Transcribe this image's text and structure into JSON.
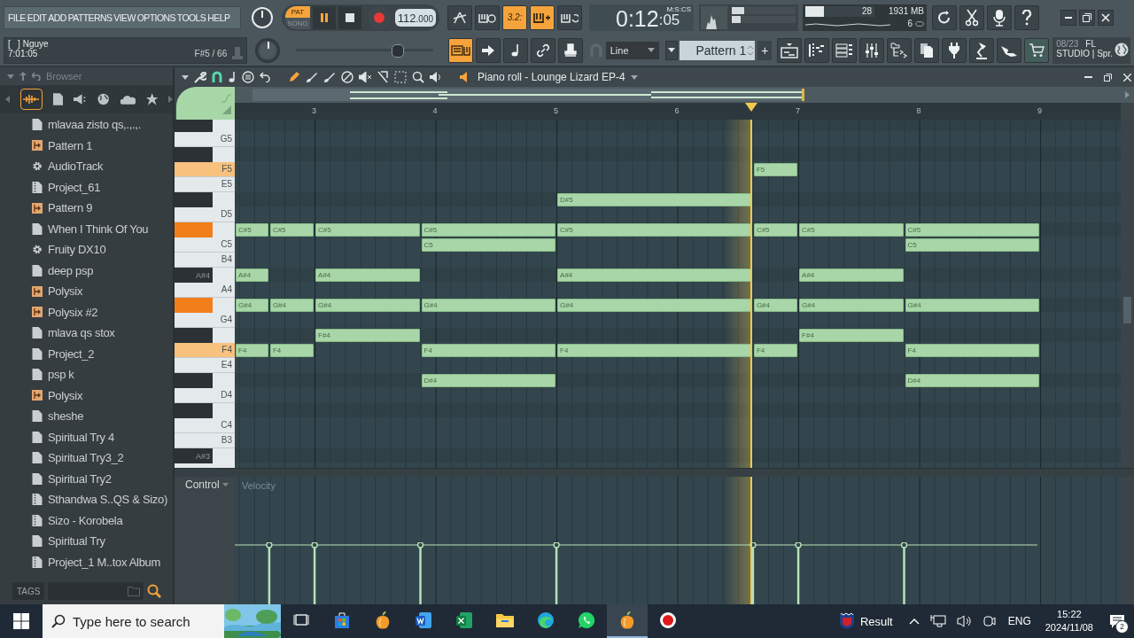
{
  "menu": [
    "FILE",
    "EDIT",
    "ADD",
    "PATTERNS",
    "VIEW",
    "OPTIONS",
    "TOOLS",
    "HELP"
  ],
  "transport": {
    "modes": [
      {
        "label": "PAT",
        "selected": true
      },
      {
        "label": "SONG",
        "selected": false
      }
    ],
    "playing": true,
    "tempo": "112",
    "tempo_decimals": ".000"
  },
  "toggles_top": [
    {
      "on": false
    },
    {
      "on": false
    },
    {
      "label": "3.2:",
      "on": true
    },
    {
      "on": true
    },
    {
      "on": false
    }
  ],
  "time": {
    "main": "0:12",
    "small": ":05",
    "format": "M:S:CS"
  },
  "cpu": {
    "level": 0.27,
    "reading": "28",
    "memory": "1931 MB",
    "polyphony": "6"
  },
  "hint": {
    "title": "[   ] Nguye",
    "time": "7:01:05",
    "note": "F#5 / 66"
  },
  "pitch_slider": {
    "level": 0.74
  },
  "toggles_bottom": [
    {
      "on": true
    },
    {
      "on": false
    },
    {
      "on": false
    },
    {
      "on": false
    },
    {
      "on": false
    }
  ],
  "snap": "Line",
  "pattern": "Pattern 1",
  "add": "+",
  "news": {
    "date": "08/23",
    "brand": "FL",
    "line2": "STUDIO | Spr."
  },
  "browser": {
    "title": "Browser",
    "items": [
      {
        "kind": "file",
        "label": "mlavaa zisto qs,.,.,."
      },
      {
        "kind": "pattern",
        "label": "Pattern 1"
      },
      {
        "kind": "plugin",
        "label": "AudioTrack"
      },
      {
        "kind": "project",
        "label": "Project_61"
      },
      {
        "kind": "pattern",
        "label": "Pattern 9"
      },
      {
        "kind": "file",
        "label": "When I Think Of You"
      },
      {
        "kind": "plugin",
        "label": "Fruity DX10"
      },
      {
        "kind": "file",
        "label": "deep psp"
      },
      {
        "kind": "pattern",
        "label": "Polysix"
      },
      {
        "kind": "pattern",
        "label": "Polysix #2"
      },
      {
        "kind": "file",
        "label": "mlava qs stox"
      },
      {
        "kind": "file",
        "label": "Project_2"
      },
      {
        "kind": "file",
        "label": "psp k"
      },
      {
        "kind": "pattern",
        "label": "Polysix"
      },
      {
        "kind": "file",
        "label": "sheshe"
      },
      {
        "kind": "file",
        "label": "Spiritual Try 4"
      },
      {
        "kind": "file",
        "label": "Spiritual Try3_2"
      },
      {
        "kind": "file",
        "label": "Spiritual Try2"
      },
      {
        "kind": "project",
        "label": "Sthandwa S..QS & Sizo)"
      },
      {
        "kind": "project",
        "label": "Sizo - Korobela"
      },
      {
        "kind": "file",
        "label": "Spiritual Try"
      },
      {
        "kind": "project",
        "label": "Project_1 M..tox Album"
      }
    ],
    "tags": "TAGS"
  },
  "piano_roll": {
    "title": "Piano roll - Lounge Lizard EP-4",
    "ruler": [
      "3",
      "4",
      "5",
      "6",
      "7",
      "8",
      "9"
    ],
    "playhead": {
      "level": 0.583
    },
    "keys": [
      {
        "kind": "black",
        "pressed": false
      },
      {
        "kind": "white",
        "label": "G5",
        "pressed": false
      },
      {
        "kind": "black",
        "pressed": false
      },
      {
        "kind": "white",
        "label": "F5",
        "pressed": true,
        "cells": [
          {
            "kind": "rest"
          },
          {
            "kind": "rest"
          },
          {
            "kind": "rest"
          },
          {
            "kind": "rest"
          },
          {
            "kind": "rest"
          },
          {
            "kind": "note",
            "label": "F5"
          },
          {
            "kind": "rest"
          },
          {
            "kind": "rest"
          }
        ]
      },
      {
        "kind": "white",
        "label": "E5",
        "pressed": false
      },
      {
        "kind": "black",
        "pressed": false,
        "cells": [
          {
            "kind": "rest"
          },
          {
            "kind": "rest"
          },
          {
            "kind": "rest"
          },
          {
            "kind": "rest"
          },
          {
            "kind": "note",
            "label": "D#5"
          },
          {
            "kind": "rest"
          },
          {
            "kind": "rest"
          },
          {
            "kind": "rest"
          }
        ]
      },
      {
        "kind": "white",
        "label": "D5",
        "pressed": false
      },
      {
        "kind": "black",
        "pressed": true,
        "cells": [
          {
            "kind": "note",
            "label": "C#5"
          },
          {
            "kind": "note",
            "label": "C#5"
          },
          {
            "kind": "note",
            "label": "C#5"
          },
          {
            "kind": "note",
            "label": "C#5"
          },
          {
            "kind": "note",
            "label": "C#5"
          },
          {
            "kind": "note",
            "label": "C#5"
          },
          {
            "kind": "note",
            "label": "C#5"
          },
          {
            "kind": "note",
            "label": "C#5"
          }
        ]
      },
      {
        "kind": "white",
        "label": "C5",
        "pressed": false,
        "cells": [
          {
            "kind": "rest"
          },
          {
            "kind": "rest"
          },
          {
            "kind": "rest"
          },
          {
            "kind": "note",
            "label": "C5"
          },
          {
            "kind": "rest"
          },
          {
            "kind": "rest"
          },
          {
            "kind": "rest"
          },
          {
            "kind": "note",
            "label": "C5"
          }
        ]
      },
      {
        "kind": "white",
        "label": "B4",
        "pressed": false
      },
      {
        "kind": "black",
        "label": "A#4",
        "pressed": false,
        "cells": [
          {
            "kind": "note",
            "label": "A#4"
          },
          {
            "kind": "rest"
          },
          {
            "kind": "note",
            "label": "A#4"
          },
          {
            "kind": "rest"
          },
          {
            "kind": "note",
            "label": "A#4"
          },
          {
            "kind": "rest"
          },
          {
            "kind": "note",
            "label": "A#4"
          },
          {
            "kind": "rest"
          }
        ]
      },
      {
        "kind": "white",
        "label": "A4",
        "pressed": false
      },
      {
        "kind": "black",
        "pressed": true,
        "cells": [
          {
            "kind": "note",
            "label": "G#4"
          },
          {
            "kind": "note",
            "label": "G#4"
          },
          {
            "kind": "note",
            "label": "G#4"
          },
          {
            "kind": "note",
            "label": "G#4"
          },
          {
            "kind": "note",
            "label": "G#4"
          },
          {
            "kind": "note",
            "label": "G#4"
          },
          {
            "kind": "note",
            "label": "G#4"
          },
          {
            "kind": "note",
            "label": "G#4"
          }
        ]
      },
      {
        "kind": "white",
        "label": "G4",
        "pressed": false
      },
      {
        "kind": "black",
        "pressed": false,
        "cells": [
          {
            "kind": "rest"
          },
          {
            "kind": "rest"
          },
          {
            "kind": "note",
            "label": "F#4"
          },
          {
            "kind": "rest"
          },
          {
            "kind": "rest"
          },
          {
            "kind": "rest"
          },
          {
            "kind": "note",
            "label": "F#4"
          },
          {
            "kind": "rest"
          }
        ]
      },
      {
        "kind": "white",
        "label": "F4",
        "pressed": true,
        "cells": [
          {
            "kind": "note",
            "label": "F4"
          },
          {
            "kind": "note",
            "label": "F4"
          },
          {
            "kind": "rest"
          },
          {
            "kind": "note",
            "label": "F4"
          },
          {
            "kind": "note",
            "label": "F4"
          },
          {
            "kind": "note",
            "label": "F4"
          },
          {
            "kind": "rest"
          },
          {
            "kind": "note",
            "label": "F4"
          }
        ]
      },
      {
        "kind": "white",
        "label": "E4",
        "pressed": false
      },
      {
        "kind": "black",
        "pressed": false,
        "cells": [
          {
            "kind": "rest"
          },
          {
            "kind": "rest"
          },
          {
            "kind": "rest"
          },
          {
            "kind": "note",
            "label": "D#4"
          },
          {
            "kind": "rest"
          },
          {
            "kind": "rest"
          },
          {
            "kind": "rest"
          },
          {
            "kind": "note",
            "label": "D#4"
          }
        ]
      },
      {
        "kind": "white",
        "label": "D4",
        "pressed": false
      },
      {
        "kind": "black",
        "pressed": false
      },
      {
        "kind": "white",
        "label": "C4",
        "pressed": false
      },
      {
        "kind": "white",
        "label": "B3",
        "pressed": false
      },
      {
        "kind": "black",
        "label": "A#3",
        "pressed": false
      },
      {
        "kind": "white",
        "pressed": false
      }
    ],
    "control": "Control",
    "velocity_label": "Velocity"
  },
  "taskbar": {
    "search_placeholder": "Type here to search",
    "apps": [
      {
        "kind": "task-view",
        "active": false
      },
      {
        "kind": "store",
        "active": false
      },
      {
        "kind": "fl",
        "active": false
      },
      {
        "kind": "word",
        "active": false
      },
      {
        "kind": "excel",
        "active": false
      },
      {
        "kind": "explorer",
        "active": false
      },
      {
        "kind": "edge",
        "active": false
      },
      {
        "kind": "whatsapp",
        "active": false
      },
      {
        "kind": "fl",
        "active": true
      },
      {
        "kind": "recorder",
        "active": false
      }
    ],
    "news": "Result",
    "language": "ENG",
    "time": "15:22",
    "date": "2024/11/08",
    "notifications": "2"
  }
}
